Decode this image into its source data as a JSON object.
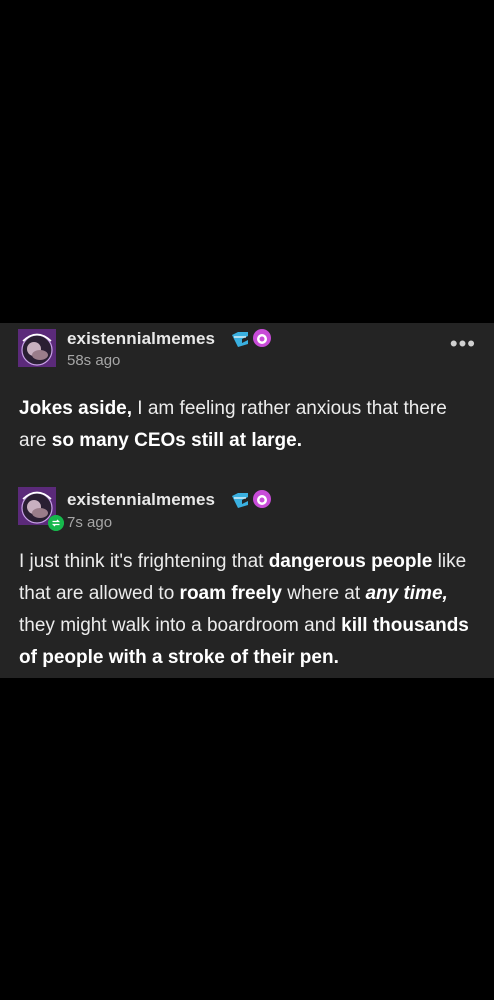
{
  "posts": [
    {
      "username": "existennialmemes",
      "time": "58s ago",
      "body": {
        "p1": "Jokes aside,",
        "p2": " I am feeling rather anxious that there are ",
        "p3": "so many CEOs still at large."
      }
    },
    {
      "username": "existennialmemes",
      "time": "7s ago",
      "body": {
        "p1": "I just think it's frightening that ",
        "p2": "dangerous people",
        "p3": " like that are allowed to ",
        "p4": "roam freely",
        "p5": " where at ",
        "p6": "any time,",
        "p7": " they might walk into a boardroom and ",
        "p8": "kill thousands of people with a stroke of their pen."
      }
    }
  ],
  "more_label": "•••",
  "icons": {
    "avatar": "avatar-icon",
    "blue_blog_icon": "blue-badge-icon",
    "pink_blog_icon": "pink-badge-icon",
    "reblog": "reblog-icon",
    "more": "more-options-icon"
  },
  "colors": {
    "background": "#000000",
    "card": "#242424",
    "text": "#ececec",
    "muted": "#a6a6a6",
    "reblog_green": "#16b84c"
  }
}
